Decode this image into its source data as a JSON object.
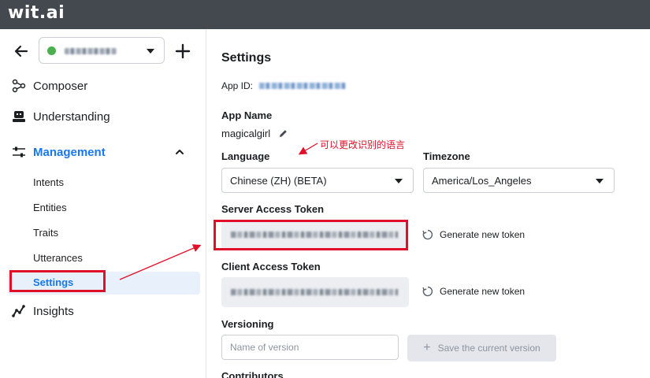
{
  "brand": {
    "logo": "wit.ai"
  },
  "sidebar": {
    "app_name": "",
    "nav": {
      "composer": "Composer",
      "understanding": "Understanding",
      "management": "Management",
      "insights": "Insights"
    },
    "management_items": [
      "Intents",
      "Entities",
      "Traits",
      "Utterances",
      "Settings"
    ]
  },
  "settings": {
    "title": "Settings",
    "app_id_label": "App ID:",
    "app_name_label": "App Name",
    "app_name_value": "magicalgirl",
    "language_label": "Language",
    "language_value": "Chinese (ZH) (BETA)",
    "timezone_label": "Timezone",
    "timezone_value": "America/Los_Angeles",
    "server_token_label": "Server Access Token",
    "client_token_label": "Client Access Token",
    "generate_token_label": "Generate new token",
    "versioning_label": "Versioning",
    "version_placeholder": "Name of version",
    "save_version_label": "Save the current version",
    "contributors_label": "Contributors"
  },
  "annotation": {
    "note": "可以更改识别的语言",
    "color": "#e0102a"
  },
  "colors": {
    "topbar": "#444950",
    "accent": "#1877f2",
    "status_dot": "#4caf50"
  }
}
